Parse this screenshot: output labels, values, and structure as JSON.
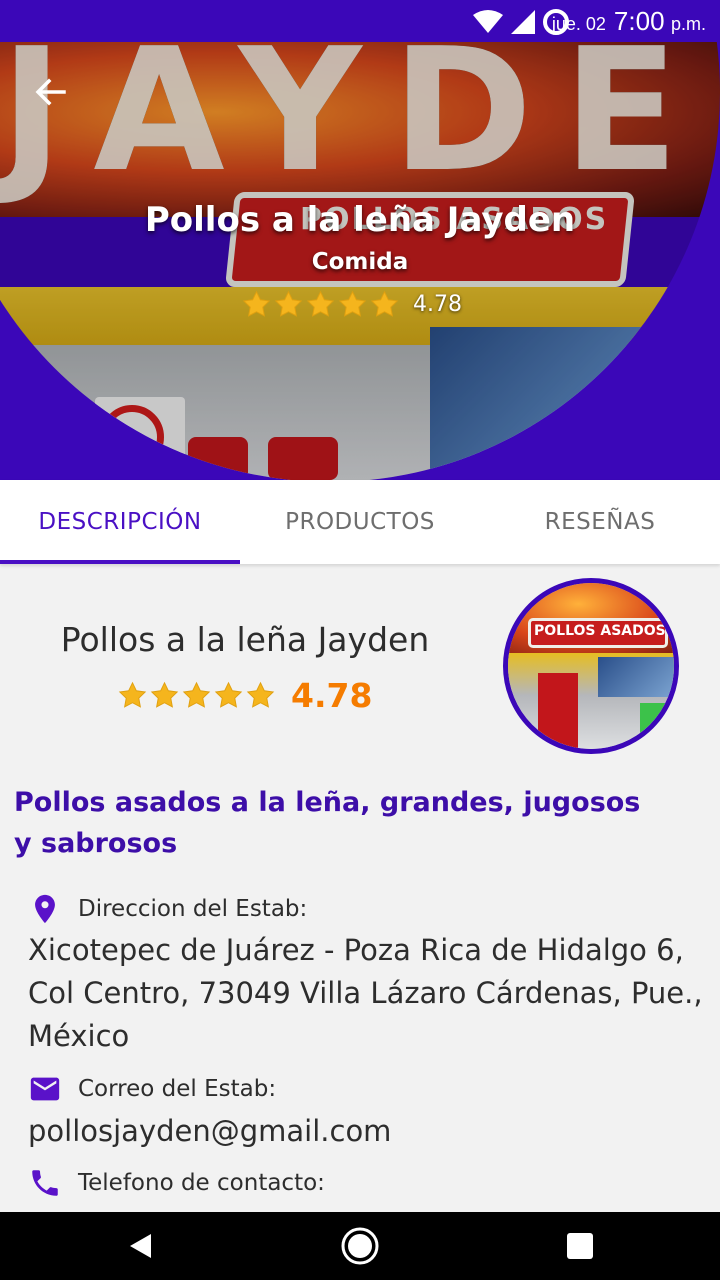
{
  "status_bar": {
    "date": "jue. 02",
    "time": "7:00",
    "time_suffix": "p.m.",
    "icons": [
      "wifi-icon",
      "signal-icon",
      "battery-circle-icon"
    ],
    "background": "#3b07b8"
  },
  "hero": {
    "photo_sign_text": "POLLOS ASADOS",
    "title": "Pollos a la leña Jayden",
    "category": "Comida",
    "rating": "4.78",
    "rating_value": 4.78,
    "star_color": "#f5b51d",
    "back_icon": "arrow-left-icon"
  },
  "tabs": [
    {
      "label": "DESCRIPCIÓN",
      "active": true
    },
    {
      "label": "PRODUCTOS",
      "active": false
    },
    {
      "label": "RESEÑAS",
      "active": false
    }
  ],
  "card": {
    "name": "Pollos a la leña Jayden",
    "rating": "4.78",
    "rating_value": 4.78,
    "avatar_sign_text": "POLLOS ASADOS"
  },
  "description": "Pollos asados a la leña, grandes, jugosos y sabrosos",
  "info": {
    "address_label": "Direccion del Estab:",
    "address_value": "Xicotepec de Juárez - Poza Rica de Hidalgo 6, Col Centro, 73049 Villa Lázaro Cárdenas, Pue., México",
    "email_label": "Correo del Estab:",
    "email_value": "pollosjayden@gmail.com",
    "phone_label": "Telefono de contacto:"
  },
  "colors": {
    "accent": "#3b07b8",
    "tab_active": "#4a10c4",
    "icon": "#5a12c9",
    "rating_orange": "#f57c00"
  },
  "nav_bar": {
    "icons": [
      "back-triangle-icon",
      "home-circle-icon",
      "recents-square-icon"
    ]
  }
}
